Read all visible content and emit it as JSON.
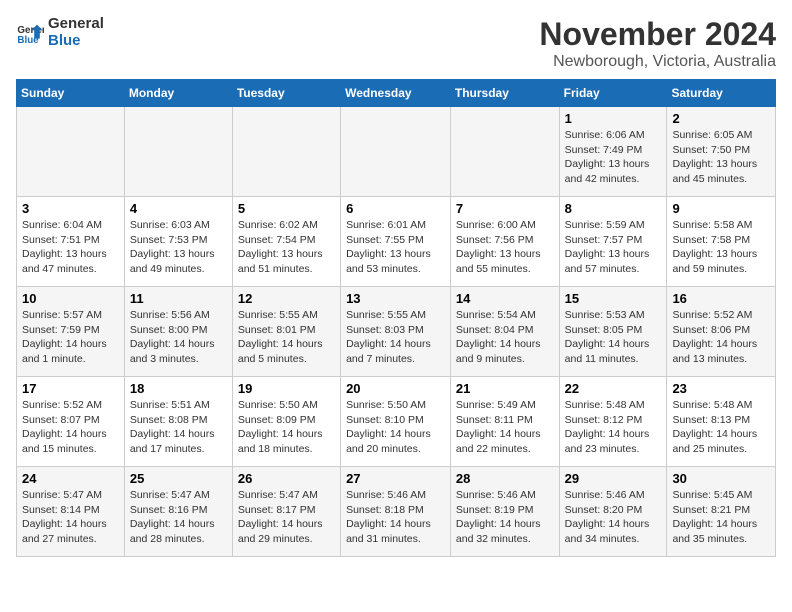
{
  "logo": {
    "text_general": "General",
    "text_blue": "Blue"
  },
  "title": "November 2024",
  "location": "Newborough, Victoria, Australia",
  "weekdays": [
    "Sunday",
    "Monday",
    "Tuesday",
    "Wednesday",
    "Thursday",
    "Friday",
    "Saturday"
  ],
  "weeks": [
    [
      {
        "day": "",
        "info": ""
      },
      {
        "day": "",
        "info": ""
      },
      {
        "day": "",
        "info": ""
      },
      {
        "day": "",
        "info": ""
      },
      {
        "day": "",
        "info": ""
      },
      {
        "day": "1",
        "info": "Sunrise: 6:06 AM\nSunset: 7:49 PM\nDaylight: 13 hours\nand 42 minutes."
      },
      {
        "day": "2",
        "info": "Sunrise: 6:05 AM\nSunset: 7:50 PM\nDaylight: 13 hours\nand 45 minutes."
      }
    ],
    [
      {
        "day": "3",
        "info": "Sunrise: 6:04 AM\nSunset: 7:51 PM\nDaylight: 13 hours\nand 47 minutes."
      },
      {
        "day": "4",
        "info": "Sunrise: 6:03 AM\nSunset: 7:53 PM\nDaylight: 13 hours\nand 49 minutes."
      },
      {
        "day": "5",
        "info": "Sunrise: 6:02 AM\nSunset: 7:54 PM\nDaylight: 13 hours\nand 51 minutes."
      },
      {
        "day": "6",
        "info": "Sunrise: 6:01 AM\nSunset: 7:55 PM\nDaylight: 13 hours\nand 53 minutes."
      },
      {
        "day": "7",
        "info": "Sunrise: 6:00 AM\nSunset: 7:56 PM\nDaylight: 13 hours\nand 55 minutes."
      },
      {
        "day": "8",
        "info": "Sunrise: 5:59 AM\nSunset: 7:57 PM\nDaylight: 13 hours\nand 57 minutes."
      },
      {
        "day": "9",
        "info": "Sunrise: 5:58 AM\nSunset: 7:58 PM\nDaylight: 13 hours\nand 59 minutes."
      }
    ],
    [
      {
        "day": "10",
        "info": "Sunrise: 5:57 AM\nSunset: 7:59 PM\nDaylight: 14 hours\nand 1 minute."
      },
      {
        "day": "11",
        "info": "Sunrise: 5:56 AM\nSunset: 8:00 PM\nDaylight: 14 hours\nand 3 minutes."
      },
      {
        "day": "12",
        "info": "Sunrise: 5:55 AM\nSunset: 8:01 PM\nDaylight: 14 hours\nand 5 minutes."
      },
      {
        "day": "13",
        "info": "Sunrise: 5:55 AM\nSunset: 8:03 PM\nDaylight: 14 hours\nand 7 minutes."
      },
      {
        "day": "14",
        "info": "Sunrise: 5:54 AM\nSunset: 8:04 PM\nDaylight: 14 hours\nand 9 minutes."
      },
      {
        "day": "15",
        "info": "Sunrise: 5:53 AM\nSunset: 8:05 PM\nDaylight: 14 hours\nand 11 minutes."
      },
      {
        "day": "16",
        "info": "Sunrise: 5:52 AM\nSunset: 8:06 PM\nDaylight: 14 hours\nand 13 minutes."
      }
    ],
    [
      {
        "day": "17",
        "info": "Sunrise: 5:52 AM\nSunset: 8:07 PM\nDaylight: 14 hours\nand 15 minutes."
      },
      {
        "day": "18",
        "info": "Sunrise: 5:51 AM\nSunset: 8:08 PM\nDaylight: 14 hours\nand 17 minutes."
      },
      {
        "day": "19",
        "info": "Sunrise: 5:50 AM\nSunset: 8:09 PM\nDaylight: 14 hours\nand 18 minutes."
      },
      {
        "day": "20",
        "info": "Sunrise: 5:50 AM\nSunset: 8:10 PM\nDaylight: 14 hours\nand 20 minutes."
      },
      {
        "day": "21",
        "info": "Sunrise: 5:49 AM\nSunset: 8:11 PM\nDaylight: 14 hours\nand 22 minutes."
      },
      {
        "day": "22",
        "info": "Sunrise: 5:48 AM\nSunset: 8:12 PM\nDaylight: 14 hours\nand 23 minutes."
      },
      {
        "day": "23",
        "info": "Sunrise: 5:48 AM\nSunset: 8:13 PM\nDaylight: 14 hours\nand 25 minutes."
      }
    ],
    [
      {
        "day": "24",
        "info": "Sunrise: 5:47 AM\nSunset: 8:14 PM\nDaylight: 14 hours\nand 27 minutes."
      },
      {
        "day": "25",
        "info": "Sunrise: 5:47 AM\nSunset: 8:16 PM\nDaylight: 14 hours\nand 28 minutes."
      },
      {
        "day": "26",
        "info": "Sunrise: 5:47 AM\nSunset: 8:17 PM\nDaylight: 14 hours\nand 29 minutes."
      },
      {
        "day": "27",
        "info": "Sunrise: 5:46 AM\nSunset: 8:18 PM\nDaylight: 14 hours\nand 31 minutes."
      },
      {
        "day": "28",
        "info": "Sunrise: 5:46 AM\nSunset: 8:19 PM\nDaylight: 14 hours\nand 32 minutes."
      },
      {
        "day": "29",
        "info": "Sunrise: 5:46 AM\nSunset: 8:20 PM\nDaylight: 14 hours\nand 34 minutes."
      },
      {
        "day": "30",
        "info": "Sunrise: 5:45 AM\nSunset: 8:21 PM\nDaylight: 14 hours\nand 35 minutes."
      }
    ]
  ]
}
